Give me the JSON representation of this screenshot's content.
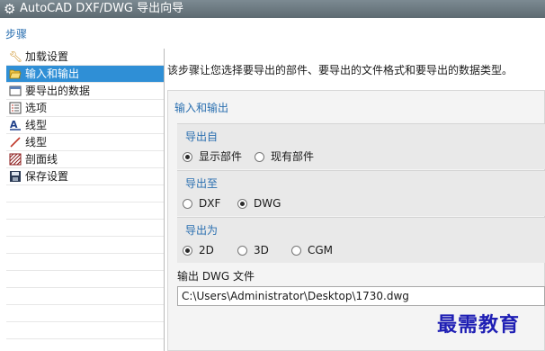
{
  "window": {
    "title": "AutoCAD DXF/DWG 导出向导",
    "icon": "gear-icon"
  },
  "steps": {
    "heading": "步骤",
    "items": [
      {
        "label": "加载设置",
        "icon": "wrench-icon"
      },
      {
        "label": "输入和输出",
        "icon": "folder-open-icon",
        "active": true
      },
      {
        "label": "要导出的数据",
        "icon": "data-window-icon"
      },
      {
        "label": "选项",
        "icon": "options-list-icon"
      },
      {
        "label": "线型",
        "icon": "linetype-A-icon"
      },
      {
        "label": "线型",
        "icon": "line-pen-icon"
      },
      {
        "label": "剖面线",
        "icon": "hatch-icon"
      },
      {
        "label": "保存设置",
        "icon": "save-disk-icon"
      }
    ]
  },
  "description": "该步骤让您选择要导出的部件、要导出的文件格式和要导出的数据类型。",
  "section": {
    "title": "输入和输出",
    "export_from": {
      "title": "导出自",
      "options": [
        {
          "label": "显示部件",
          "selected": true
        },
        {
          "label": "现有部件",
          "selected": false
        }
      ]
    },
    "export_to": {
      "title": "导出至",
      "options": [
        {
          "label": "DXF",
          "selected": false
        },
        {
          "label": "DWG",
          "selected": true
        }
      ]
    },
    "export_as": {
      "title": "导出为",
      "options": [
        {
          "label": "2D",
          "selected": true
        },
        {
          "label": "3D",
          "selected": false
        },
        {
          "label": "CGM",
          "selected": false
        }
      ]
    },
    "output_file": {
      "label": "输出 DWG 文件",
      "value": "C:\\Users\\Administrator\\Desktop\\1730.dwg"
    }
  },
  "watermark": "最需教育",
  "colors": {
    "accent": "#2a6fb0",
    "selection": "#2f8fd6",
    "titlebar": "#6c7a82"
  }
}
